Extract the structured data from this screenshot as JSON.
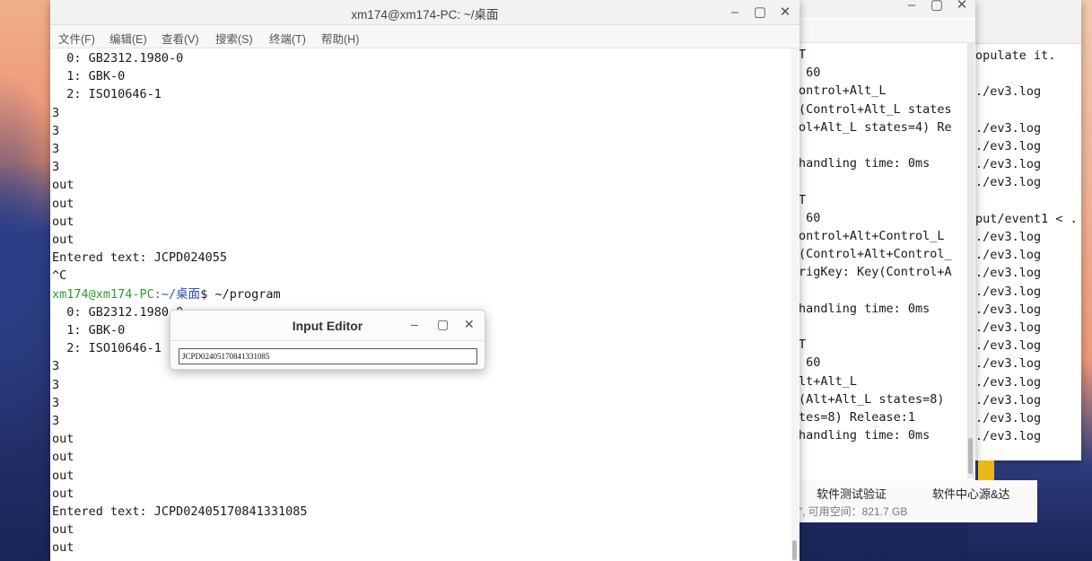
{
  "main_terminal": {
    "title": "xm174@xm174-PC: ~/桌面",
    "menu": [
      "文件(F)",
      "编辑(E)",
      "查看(V)",
      "搜索(S)",
      "终端(T)",
      "帮助(H)"
    ],
    "lines": [
      "  0: GB2312.1980-0",
      "  1: GBK-0",
      "  2: ISO10646-1",
      "3",
      "3",
      "3",
      "3",
      "out",
      "out",
      "out",
      "out",
      "Entered text: JCPD024055",
      "^C",
      "",
      "  0: GB2312.1980-0",
      "  1: GBK-0",
      "  2: ISO10646-1",
      "3",
      "3",
      "3",
      "3",
      "out",
      "out",
      "out",
      "out",
      "Entered text: JCPD02405170841331085",
      "out",
      "out"
    ],
    "prompt_user": "xm174@xm174-PC:",
    "prompt_dir": "~/桌面",
    "prompt_cmd": "$ ~/program"
  },
  "input_editor": {
    "title": "Input Editor",
    "value": "JCPD02405170841331085"
  },
  "second_terminal": {
    "lines": [
      "T",
      " 60",
      "ontrol+Alt_L",
      "(Control+Alt_L states",
      "ol+Alt_L states=4) Re",
      "",
      "handling time: 0ms",
      "",
      "T",
      " 60",
      "ontrol+Alt+Control_L",
      "(Control+Alt+Control_",
      "rigKey: Key(Control+A",
      "",
      "handling time: 0ms",
      "",
      "T",
      " 60",
      "lt+Alt_L",
      "(Alt+Alt_L states=8)",
      "tes=8) Release:1",
      "handling time: 0ms"
    ]
  },
  "third_terminal": {
    "lines": [
      "opulate it.",
      "",
      "./ev3.log",
      "",
      "./ev3.log",
      "./ev3.log",
      "./ev3.log",
      "./ev3.log",
      "",
      "put/event1 < .",
      "./ev3.log",
      "./ev3.log",
      "./ev3.log",
      "./ev3.log",
      "./ev3.log",
      "./ev3.log",
      "./ev3.log",
      "./ev3.log",
      "./ev3.log",
      "./ev3.log",
      "./ev3.log",
      "./ev3.log"
    ]
  },
  "taskbar_snippet": {
    "item1": "软件测试验证",
    "item2": "软件中心源&达",
    "space": "”, 可用空间：821.7 GB"
  }
}
